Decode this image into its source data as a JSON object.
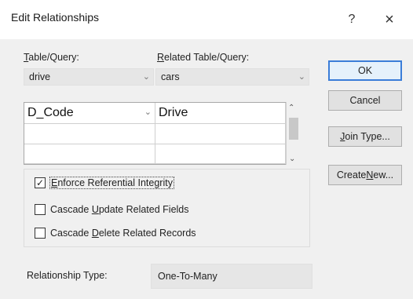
{
  "window": {
    "title": "Edit Relationships",
    "help_glyph": "?",
    "close_glyph": "×"
  },
  "labels": {
    "table_query_first": "T",
    "table_query_rest": "able/Query:",
    "related_first": "R",
    "related_rest": "elated Table/Query:"
  },
  "combos": {
    "table_value": "drive",
    "related_value": "cars"
  },
  "grid": {
    "rows": [
      {
        "left": "D_Code",
        "right": "Drive"
      },
      {
        "left": "",
        "right": ""
      },
      {
        "left": "",
        "right": ""
      }
    ]
  },
  "options": {
    "enforce": {
      "pre": "",
      "key": "E",
      "post": "nforce Referential Integrity",
      "checked": true
    },
    "cascade_update": {
      "pre": "Cascade ",
      "key": "U",
      "post": "pdate Related Fields",
      "checked": false
    },
    "cascade_delete": {
      "pre": "Cascade ",
      "key": "D",
      "post": "elete Related Records",
      "checked": false
    }
  },
  "relationship": {
    "label": "Relationship Type:",
    "value": "One-To-Many"
  },
  "buttons": {
    "ok": "OK",
    "cancel": "Cancel",
    "join_type_key": "J",
    "join_type_rest": "oin Type...",
    "create_new_pre": "Create ",
    "create_new_key": "N",
    "create_new_post": "ew..."
  },
  "check_glyph": "✓"
}
